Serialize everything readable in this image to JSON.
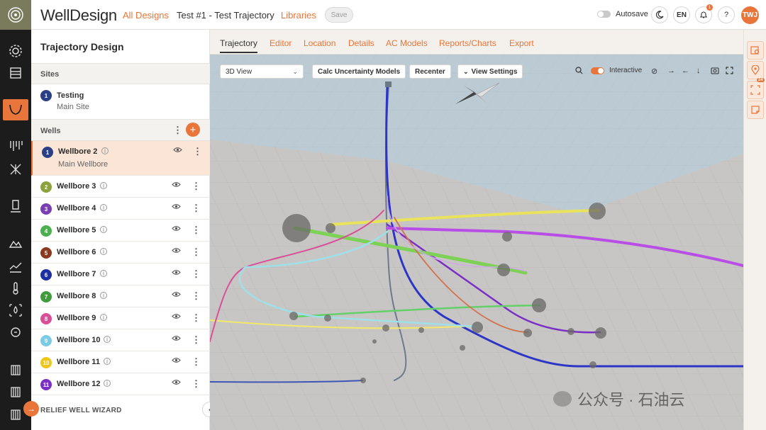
{
  "header": {
    "brand": "WellDesign",
    "nav_all_designs": "All Designs",
    "nav_current": "Test #1 - Test Trajectory",
    "nav_libraries": "Libraries",
    "save_label": "Save",
    "autosave_label": "Autosave",
    "language": "EN",
    "notification_count": "1",
    "help": "?",
    "avatar_initials": "TWJ"
  },
  "panel": {
    "title": "Trajectory Design",
    "sites_label": "Sites",
    "site": {
      "number": "1",
      "name": "Testing",
      "sub": "Main Site"
    },
    "wells_label": "Wells",
    "add_label": "+",
    "wells": [
      {
        "number": "1",
        "name": "Wellbore 2",
        "sub": "Main Wellbore",
        "color": "#2b3f86"
      },
      {
        "number": "2",
        "name": "Wellbore 3",
        "color": "#8aa33c"
      },
      {
        "number": "3",
        "name": "Wellbore 4",
        "color": "#7b3fb5"
      },
      {
        "number": "4",
        "name": "Wellbore 5",
        "color": "#4caf50"
      },
      {
        "number": "5",
        "name": "Wellbore 6",
        "color": "#8b3a1f"
      },
      {
        "number": "6",
        "name": "Wellbore 7",
        "color": "#1e2fa3"
      },
      {
        "number": "7",
        "name": "Wellbore 8",
        "color": "#3f9b3c"
      },
      {
        "number": "8",
        "name": "Wellbore 9",
        "color": "#d84f98"
      },
      {
        "number": "9",
        "name": "Wellbore 10",
        "color": "#7ccbe6"
      },
      {
        "number": "10",
        "name": "Wellbore 11",
        "color": "#f2c617"
      },
      {
        "number": "11",
        "name": "Wellbore 12",
        "color": "#7a2fc6"
      }
    ],
    "relief_label": "RELIEF WELL WIZARD"
  },
  "tabs": [
    "Trajectory",
    "Editor",
    "Location",
    "Details",
    "AC Models",
    "Reports/Charts",
    "Export"
  ],
  "active_tab": "Trajectory",
  "viewport": {
    "view_select": "3D View",
    "calc_button": "Calc Uncertainty Models",
    "recenter_button": "Recenter",
    "view_settings_button": "View Settings",
    "interactive_label": "Interactive",
    "interactive_on": true
  },
  "right_strip": {
    "badge": "24"
  },
  "watermark": "公众号 · 石油云",
  "colors": {
    "accent": "#e8753a",
    "rail": "#1c1c1c"
  }
}
